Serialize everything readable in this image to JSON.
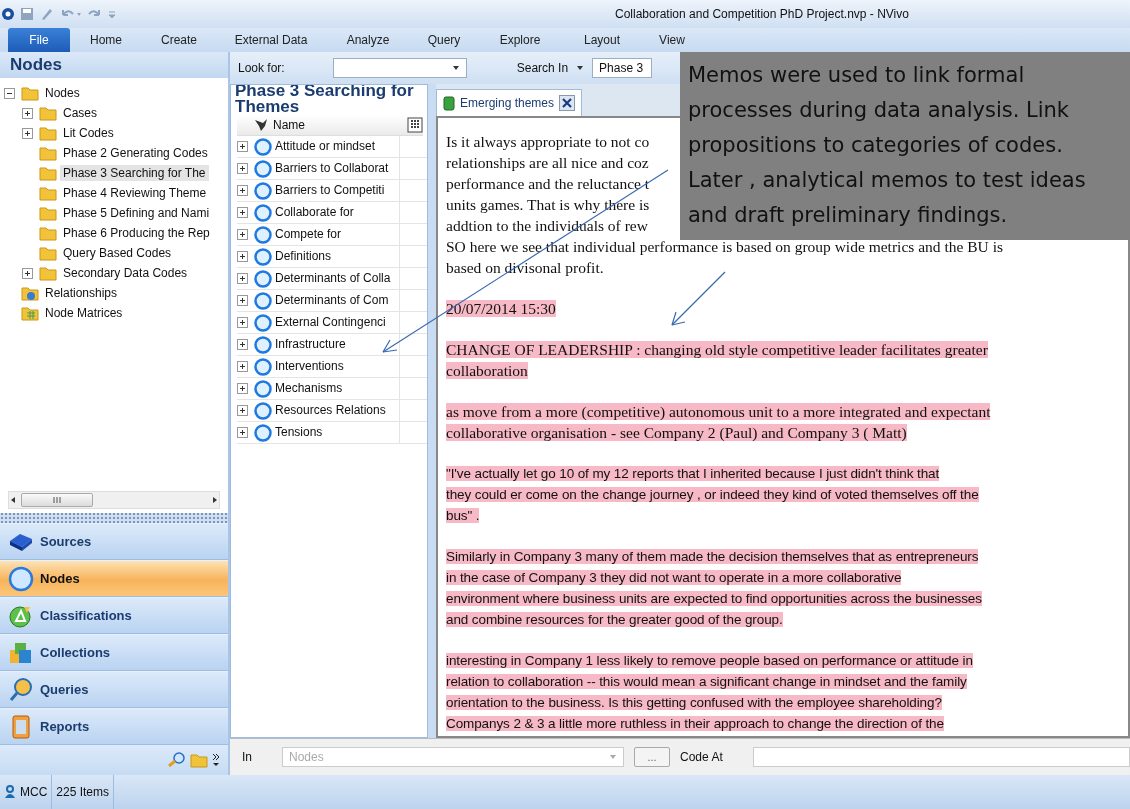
{
  "window": {
    "title": "Collaboration and Competition PhD Project.nvp - NVivo"
  },
  "ribbon_tabs": [
    {
      "label": "File",
      "selected": true
    },
    {
      "label": "Home",
      "selected": false
    },
    {
      "label": "Create",
      "selected": false
    },
    {
      "label": "External Data",
      "selected": false
    },
    {
      "label": "Analyze",
      "selected": false
    },
    {
      "label": "Query",
      "selected": false
    },
    {
      "label": "Explore",
      "selected": false
    },
    {
      "label": "Layout",
      "selected": false
    },
    {
      "label": "View",
      "selected": false
    }
  ],
  "navigation": {
    "title": "Nodes",
    "tree": [
      {
        "label": "Nodes",
        "kind": "folder",
        "expanded": true,
        "selected": false,
        "children": [
          {
            "label": "Cases",
            "kind": "folder",
            "expanded": false,
            "selected": false
          },
          {
            "label": "Lit Codes",
            "kind": "folder",
            "expanded": false,
            "selected": false
          },
          {
            "label": "Phase 2 Generating Codes",
            "kind": "folder",
            "selected": false
          },
          {
            "label": "Phase 3 Searching for The",
            "kind": "folder",
            "selected": true
          },
          {
            "label": "Phase 4 Reviewing Theme",
            "kind": "folder",
            "selected": false
          },
          {
            "label": "Phase 5 Defining and Nami",
            "kind": "folder",
            "selected": false
          },
          {
            "label": "Phase 6 Producing the Rep",
            "kind": "folder",
            "selected": false
          },
          {
            "label": "Query Based Codes",
            "kind": "folder",
            "selected": false
          },
          {
            "label": "Secondary Data Codes",
            "kind": "folder",
            "expanded": false,
            "selected": false
          }
        ]
      },
      {
        "label": "Relationships",
        "kind": "relationships",
        "selected": false
      },
      {
        "label": "Node Matrices",
        "kind": "matrices",
        "selected": false
      }
    ],
    "sections": [
      {
        "label": "Sources",
        "kind": "sources",
        "selected": false
      },
      {
        "label": "Nodes",
        "kind": "nodes",
        "selected": true
      },
      {
        "label": "Classifications",
        "kind": "classifications",
        "selected": false
      },
      {
        "label": "Collections",
        "kind": "collections",
        "selected": false
      },
      {
        "label": "Queries",
        "kind": "queries",
        "selected": false
      },
      {
        "label": "Reports",
        "kind": "reports",
        "selected": false
      }
    ]
  },
  "find_bar": {
    "look_for_label": "Look for:",
    "search_in_label": "Search In",
    "search_in_value": "Phase 3"
  },
  "node_list": {
    "title": "Phase 3 Searching for Themes",
    "column": "Name",
    "rows": [
      {
        "name": "Attitude or mindset",
        "expanded": false
      },
      {
        "name": "Barriers to Collaborat",
        "expanded": false
      },
      {
        "name": "Barriers to Competiti",
        "expanded": false
      },
      {
        "name": "Collaborate for",
        "expanded": false
      },
      {
        "name": "Compete for",
        "expanded": false
      },
      {
        "name": "Definitions",
        "expanded": false
      },
      {
        "name": "Determinants of Colla",
        "expanded": false
      },
      {
        "name": "Determinants of Com",
        "expanded": false
      },
      {
        "name": "External Contingenci",
        "expanded": false
      },
      {
        "name": "Infrastructure",
        "expanded": false
      },
      {
        "name": "Interventions",
        "expanded": false
      },
      {
        "name": "Mechanisms",
        "expanded": false
      },
      {
        "name": "Resources Relations",
        "expanded": false
      },
      {
        "name": "Tensions",
        "expanded": false
      }
    ]
  },
  "document": {
    "tab": "Emerging themes",
    "paragraphs": [
      {
        "kind": "serif",
        "highlighted": false,
        "lines": [
          " Is it always appropriate to not co",
          "relationships are all nice and coz",
          "performance and the reluctance t",
          "units games. That is why there is",
          "addtion to the individuals of rew",
          " SO here we see that individual performance is based on group wide metrics and the BU is",
          "based on divisonal profit."
        ]
      },
      {
        "kind": "serif",
        "highlighted": true,
        "lines": [
          " 20/07/2014  15:30 "
        ]
      },
      {
        "kind": "serif",
        "highlighted": true,
        "lines": [
          "CHANGE OF LEADERSHIP  : changing old style competitive leader facilitates greater ",
          "collaboration "
        ]
      },
      {
        "kind": "serif",
        "highlighted": true,
        "lines": [
          "as move from a more (competitive) autonomous unit to a more integrated and expectant",
          "collaborative organisation  - see Company 2 (Paul) and Company 3 ( Matt)"
        ]
      },
      {
        "kind": "sans",
        "highlighted": true,
        "lines": [
          "\"I've actually  let go  10 of my 12 reports that I inherited  because I just didn't think that",
          "they could er come on the change journey , or indeed they kind of voted themselves off the",
          "bus\" . "
        ]
      },
      {
        "kind": "sans",
        "highlighted": true,
        "lines": [
          "Similarly in Company 3 many of them made the decision themselves that as entrepreneurs",
          "in the case of Company 3 they did not want to operate in a more  collaborative ",
          "environment where business units are expected to find opportunities across the businesses",
          "and combine resources for the greater good of the group. "
        ]
      },
      {
        "kind": "sans",
        "highlighted": true,
        "lines": [
          "interesting in Company 1 less likely to remove people based on performance or attitude in",
          "relation to collaboration  -- this would mean a significant change in mindset and the family",
          "orientation to the business. Is this getting confused with the employee shareholding? ",
          "Companys 2 & 3 a little more ruthless in their approach to change the direction of the"
        ]
      }
    ]
  },
  "coding_bar": {
    "in_label": "In",
    "in_value": "Nodes",
    "browse_button": "...",
    "code_at_label": "Code At"
  },
  "status_bar": {
    "user": "MCC",
    "items": "225 Items"
  },
  "callout": {
    "lines": [
      "Memos were used to link formal",
      "processes during data analysis.  Link",
      "propositions to categories of codes.",
      "Later , analytical memos to test ideas",
      "and draft preliminary findings."
    ]
  }
}
